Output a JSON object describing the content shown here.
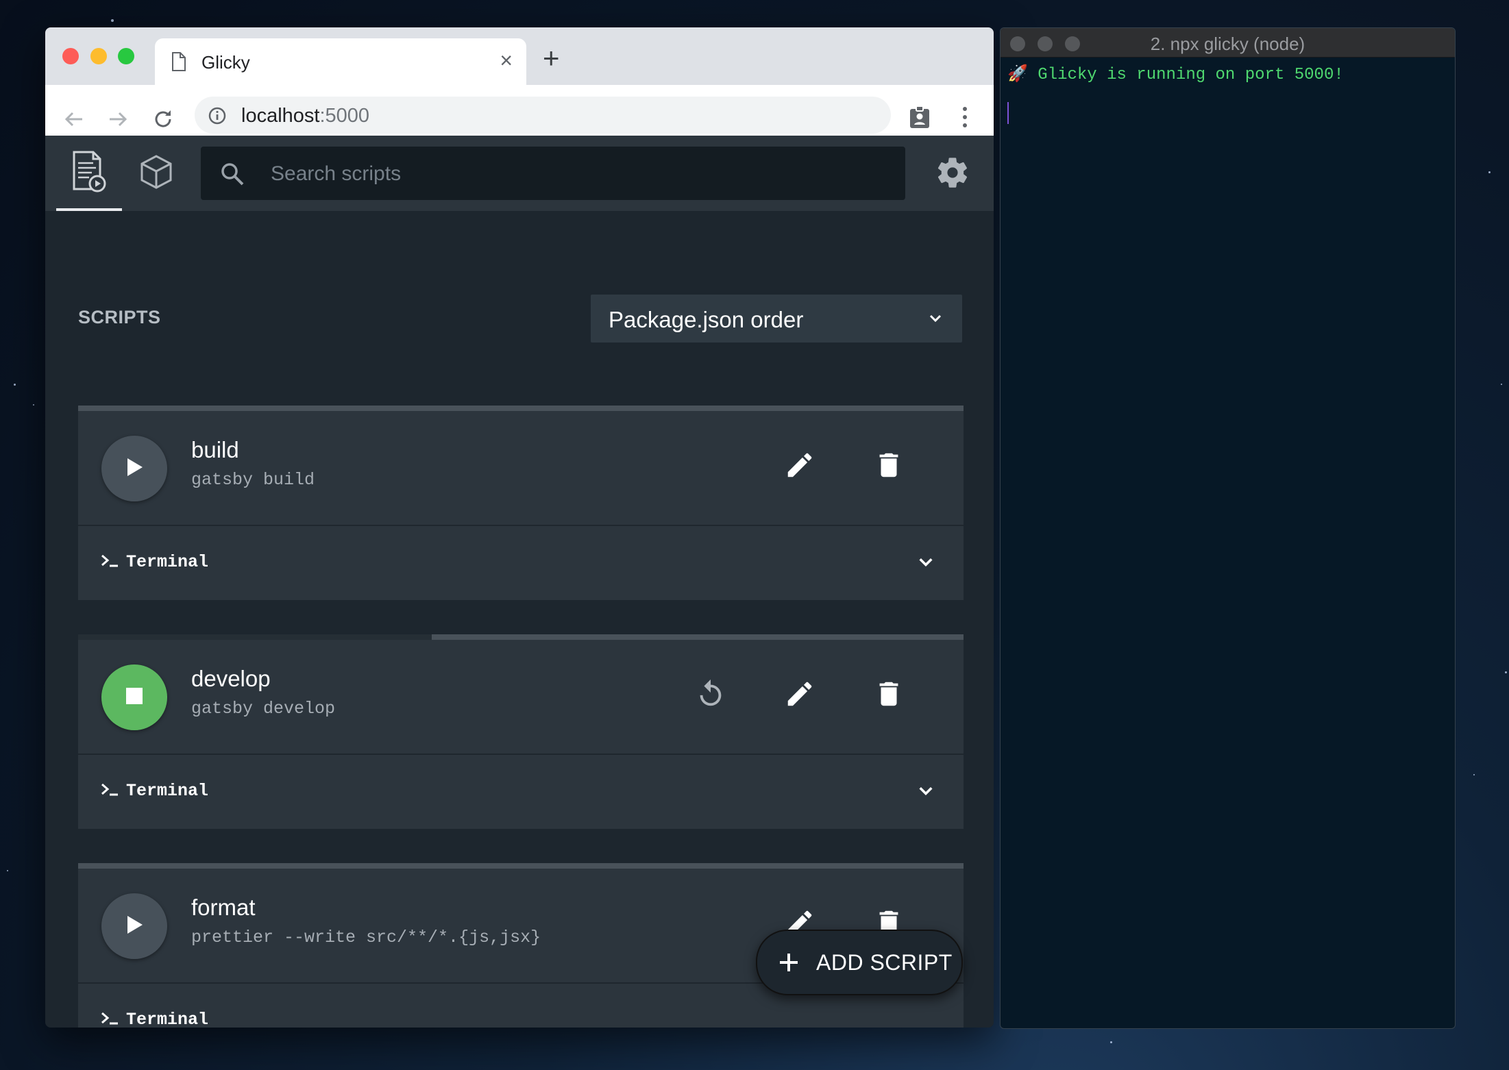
{
  "browser": {
    "tab_title": "Glicky",
    "new_tab_label": "+",
    "close_label": "×",
    "url_host": "localhost",
    "url_port": ":5000"
  },
  "app": {
    "search_placeholder": "Search scripts",
    "section_title": "SCRIPTS",
    "sort_value": "Package.json order",
    "terminal_label": "Terminal",
    "add_script_label": "ADD SCRIPT",
    "scripts": [
      {
        "name": "build",
        "command": "gatsby build",
        "state": "stopped"
      },
      {
        "name": "develop",
        "command": "gatsby develop",
        "state": "running"
      },
      {
        "name": "format",
        "command": "prettier --write src/**/*.{js,jsx}",
        "state": "stopped"
      }
    ]
  },
  "terminal": {
    "title": "2. npx glicky (node)",
    "output_line": "🚀 Glicky is running on port 5000!"
  },
  "colors": {
    "running_green": "#5cb860",
    "terminal_text": "#4fd86f",
    "app_background": "#1d262e",
    "card_background": "#2c353d"
  }
}
